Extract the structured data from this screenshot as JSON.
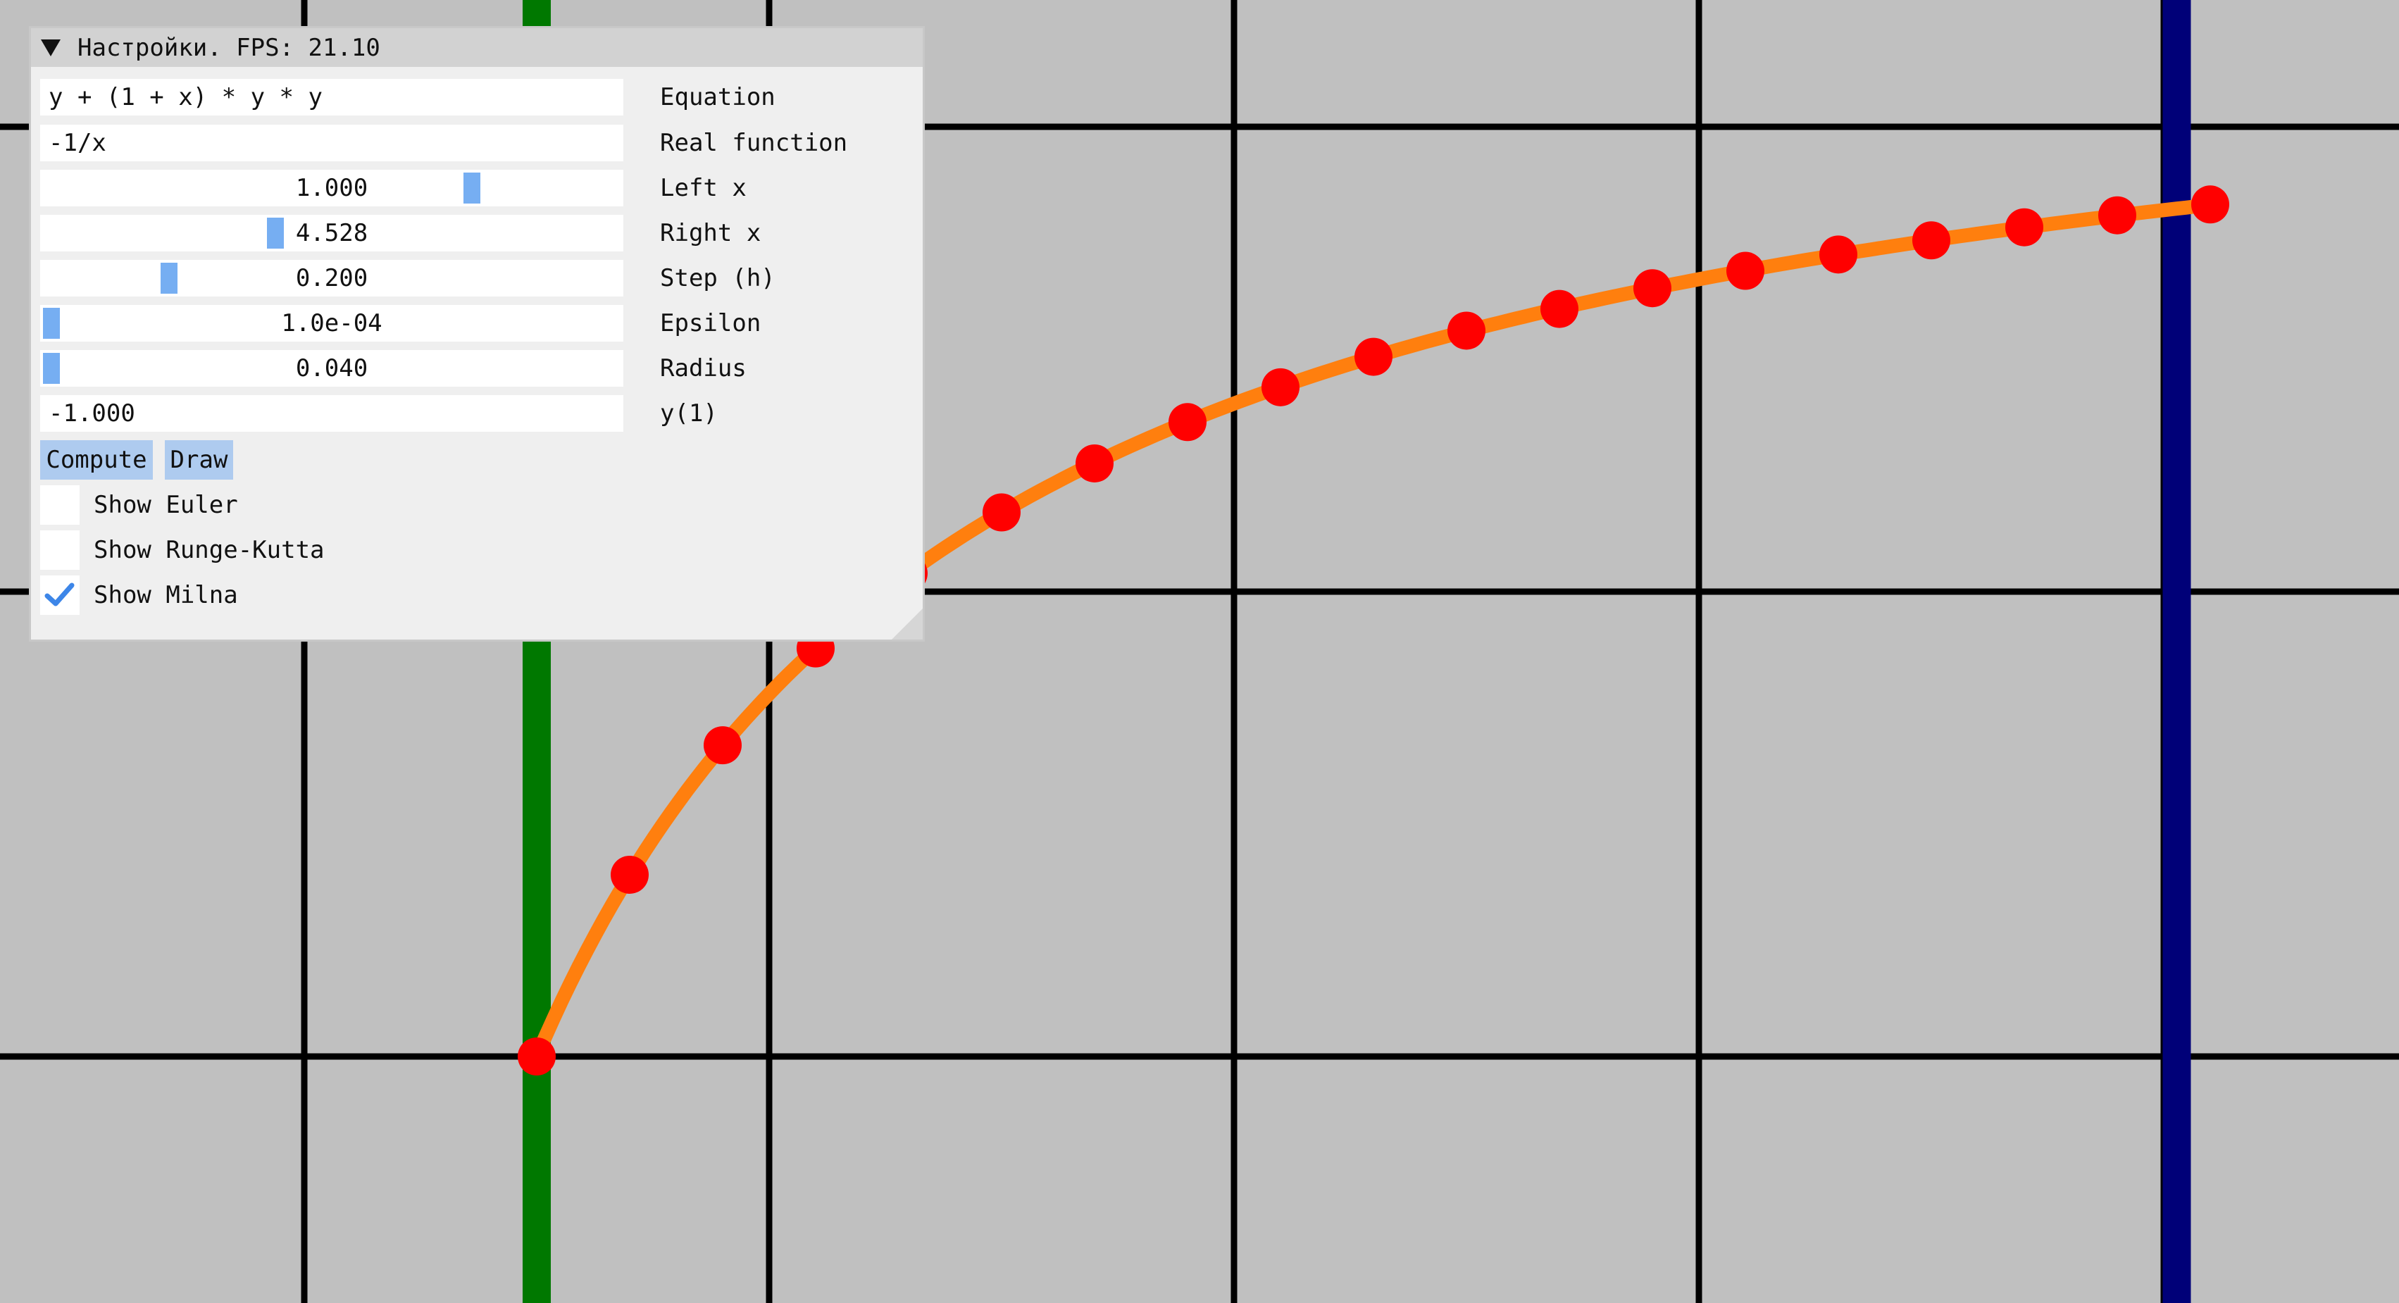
{
  "panel": {
    "title": "Настройки. FPS: 21.10",
    "equation": {
      "value": "y + (1 + x) * y * y",
      "label": "Equation"
    },
    "real_function": {
      "value": "-1/x",
      "label": "Real function"
    },
    "left_x": {
      "value": "1.000",
      "label": "Left x",
      "fraction": 0.75
    },
    "right_x": {
      "value": "4.528",
      "label": "Right x",
      "fraction": 0.4
    },
    "step": {
      "value": "0.200",
      "label": "Step (h)",
      "fraction": 0.21
    },
    "epsilon": {
      "value": "1.0e-04",
      "label": "Epsilon",
      "fraction": 0.0
    },
    "radius": {
      "value": "0.040",
      "label": "Radius",
      "fraction": 0.0
    },
    "y1": {
      "value": "-1.000",
      "label": "y(1)"
    },
    "buttons": {
      "compute": "Compute",
      "draw": "Draw"
    },
    "checkboxes": [
      {
        "label": "Show Euler",
        "checked": false
      },
      {
        "label": "Show Runge-Kutta",
        "checked": false
      },
      {
        "label": "Show Milna",
        "checked": true
      }
    ]
  },
  "colors": {
    "background": "#c0c0c0",
    "grid": "#000000",
    "left_bound": "#007800",
    "right_bound": "#000078",
    "curve": "#ff7f0e",
    "points": "#ff0000",
    "accent": "#76aef2",
    "button": "#aecbef",
    "check": "#3d86e8"
  },
  "plot": {
    "x_range": [
      1.0,
      4.528
    ],
    "step": 0.2,
    "grid_x": [
      0.5,
      1.5,
      2.5,
      3.5,
      4.5
    ],
    "grid_y": [
      -1.0,
      0.0,
      1.0
    ],
    "method": "Milna",
    "solution_points": [
      [
        1.0,
        -1.0
      ],
      [
        1.2,
        -0.833
      ],
      [
        1.4,
        -0.714
      ],
      [
        1.6,
        -0.625
      ],
      [
        1.8,
        -0.556
      ],
      [
        2.0,
        -0.5
      ],
      [
        2.2,
        -0.455
      ],
      [
        2.4,
        -0.417
      ],
      [
        2.6,
        -0.385
      ],
      [
        2.8,
        -0.357
      ],
      [
        3.0,
        -0.333
      ],
      [
        3.2,
        -0.313
      ],
      [
        3.4,
        -0.294
      ],
      [
        3.6,
        -0.278
      ],
      [
        3.8,
        -0.263
      ],
      [
        4.0,
        -0.25
      ],
      [
        4.2,
        -0.238
      ],
      [
        4.4,
        -0.227
      ],
      [
        4.6,
        -0.217
      ]
    ]
  }
}
